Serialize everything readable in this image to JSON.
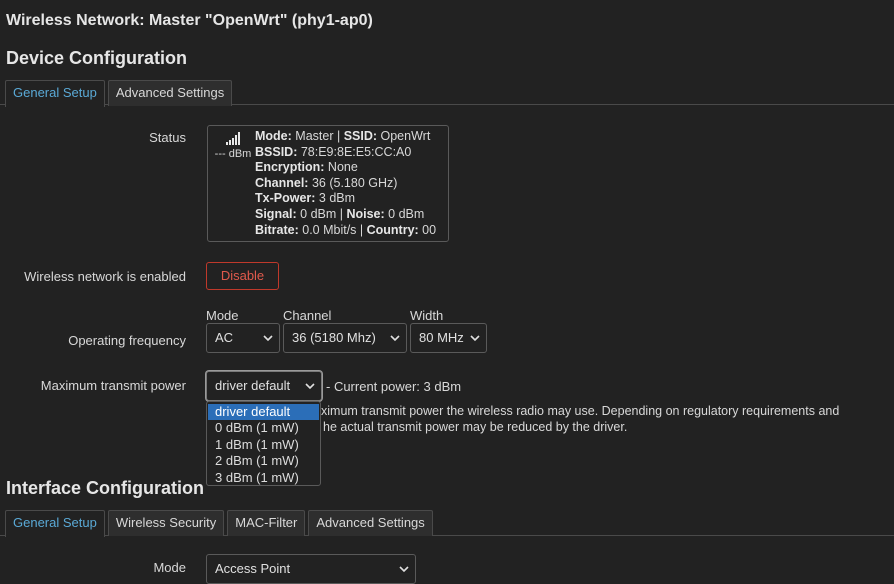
{
  "page": {
    "title": "Wireless Network: Master \"OpenWrt\" (phy1-ap0)"
  },
  "device": {
    "title": "Device Configuration",
    "tabs": [
      {
        "label": "General Setup",
        "active": true
      },
      {
        "label": "Advanced Settings",
        "active": false
      }
    ]
  },
  "status": {
    "label": "Status",
    "signal_icon": "signal-bars-icon",
    "dbm": "--- dBm",
    "lines": [
      [
        {
          "k": "Mode:",
          "v": " Master | "
        },
        {
          "k": "SSID:",
          "v": " OpenWrt"
        }
      ],
      [
        {
          "k": "BSSID:",
          "v": " 78:E9:8E:E5:CC:A0"
        }
      ],
      [
        {
          "k": "Encryption:",
          "v": " None"
        }
      ],
      [
        {
          "k": "Channel:",
          "v": " 36 (5.180 GHz)"
        }
      ],
      [
        {
          "k": "Tx-Power:",
          "v": " 3 dBm"
        }
      ],
      [
        {
          "k": "Signal:",
          "v": " 0 dBm | "
        },
        {
          "k": "Noise:",
          "v": " 0 dBm"
        }
      ],
      [
        {
          "k": "Bitrate:",
          "v": " 0.0 Mbit/s | "
        },
        {
          "k": "Country:",
          "v": " 00"
        }
      ]
    ]
  },
  "enabled": {
    "label": "Wireless network is enabled",
    "button": "Disable"
  },
  "frequency": {
    "label": "Operating frequency",
    "mode_label": "Mode",
    "mode_value": "AC",
    "channel_label": "Channel",
    "channel_value": "36 (5180 Mhz)",
    "width_label": "Width",
    "width_value": "80 MHz"
  },
  "txpower": {
    "label": "Maximum transmit power",
    "value": "driver default",
    "current": "- Current power: 3 dBm",
    "options": [
      "driver default",
      "0 dBm (1 mW)",
      "1 dBm (1 mW)",
      "2 dBm (1 mW)",
      "3 dBm (1 mW)"
    ],
    "desc_line1": "ximum transmit power the wireless radio may use. Depending on regulatory requirements and",
    "desc_line2": "he actual transmit power may be reduced by the driver."
  },
  "interface": {
    "title": "Interface Configuration",
    "tabs": [
      {
        "label": "General Setup",
        "active": true
      },
      {
        "label": "Wireless Security",
        "active": false
      },
      {
        "label": "MAC-Filter",
        "active": false
      },
      {
        "label": "Advanced Settings",
        "active": false
      }
    ],
    "mode_label": "Mode",
    "mode_value": "Access Point"
  },
  "colors": {
    "accent": "#5aa9d6",
    "danger": "#e05a4c",
    "highlight": "#2b6eb8",
    "background": "#222222"
  }
}
